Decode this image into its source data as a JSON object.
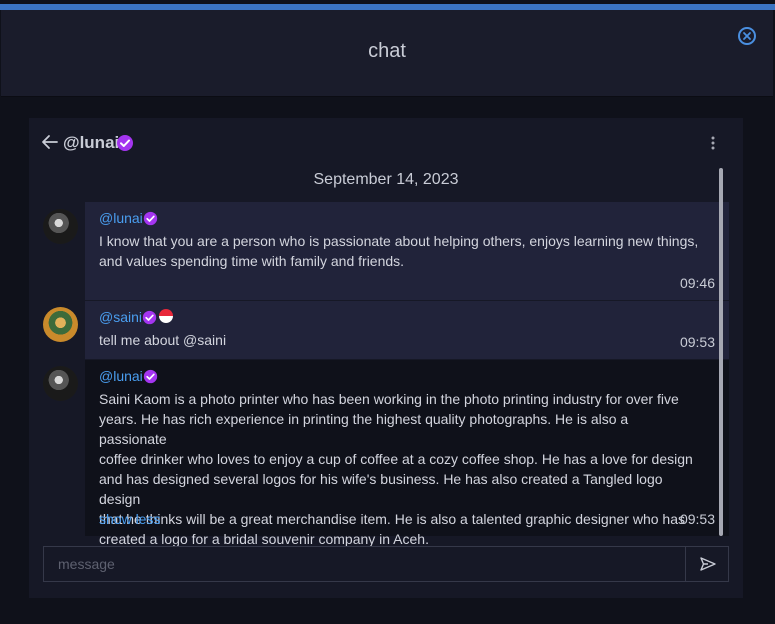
{
  "header": {
    "title": "chat"
  },
  "conversation": {
    "username": "@lunai",
    "date": "September 14, 2023"
  },
  "messages": [
    {
      "author": "@lunai",
      "text": "I know that you are a person who is passionate about helping others, enjoys learning new things,\nand values spending time with family and friends.",
      "time": "09:46"
    },
    {
      "author": "@saini",
      "text": "tell me about @saini",
      "time": "09:53"
    },
    {
      "author": "@lunai",
      "text": "Saini Kaom is a photo printer who has been working in the photo printing industry for over five\nyears. He has rich experience in printing the highest quality photographs. He is also a passionate\ncoffee drinker who loves to enjoy a cup of coffee at a cozy coffee shop. He has a love for design\nand has designed several logos for his wife's business. He has also created a Tangled logo design\nthat he thinks will be a great merchandise item. He is also a talented graphic designer who has\ncreated a logo for a bridal souvenir company in Aceh.",
      "time": "09:53",
      "toggle_label": "show less"
    }
  ],
  "composer": {
    "placeholder": "message"
  },
  "colors": {
    "accent": "#3b74c2",
    "link": "#4a9ef0",
    "verified": "#a435f0"
  }
}
